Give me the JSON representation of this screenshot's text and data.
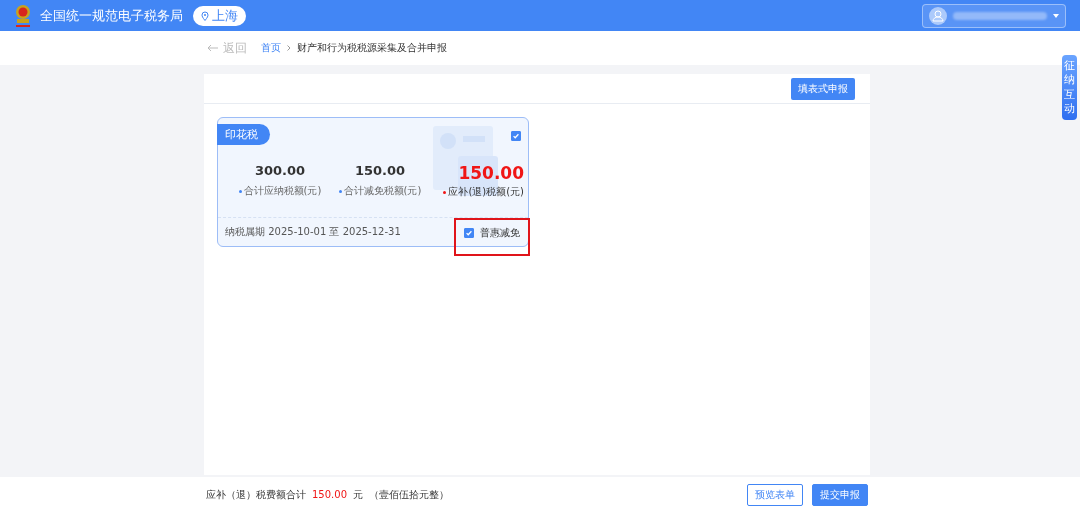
{
  "header": {
    "title": "全国统一规范电子税务局",
    "region": "上海"
  },
  "breadcrumb": {
    "back": "返回",
    "items": [
      "首页",
      "财产和行为税税源采集及合并申报"
    ]
  },
  "toolbar": {
    "button": "填表式申报"
  },
  "side_tab": {
    "label": "征纳互动"
  },
  "cards": [
    {
      "tag": "印花税",
      "checked": true,
      "stats": [
        {
          "value": "300.00",
          "label": "合计应纳税额(元)",
          "kind": "normal"
        },
        {
          "value": "150.00",
          "label": "合计减免税额(元)",
          "kind": "normal"
        },
        {
          "value": "150.00",
          "label": "应补(退)税额(元)",
          "kind": "highlight"
        }
      ],
      "period": "纳税属期 2025-10-01 至 2025-12-31",
      "relief": {
        "label": "普惠减免",
        "checked": true,
        "highlighted": true
      }
    }
  ],
  "footer": {
    "label": "应补（退）税费额合计",
    "amount": "150.00",
    "unit": "元",
    "words": "（壹佰伍拾元整）",
    "buttons": [
      {
        "label": "预览表单",
        "kind": "secondary"
      },
      {
        "label": "提交申报",
        "kind": "primary"
      }
    ]
  }
}
